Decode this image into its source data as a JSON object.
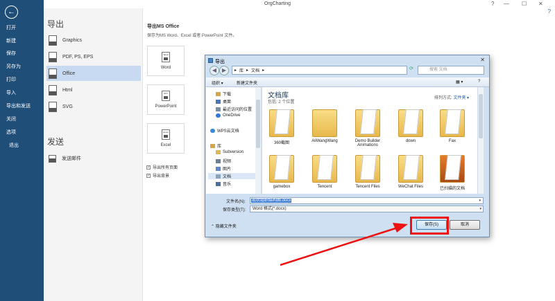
{
  "app": {
    "title": "OrgCharting",
    "help": "?"
  },
  "sidebar": {
    "items": [
      "打开",
      "新建",
      "保存",
      "另存为",
      "打印",
      "导入",
      "导出和发送",
      "关闭",
      "选项",
      "退出"
    ]
  },
  "column2": {
    "export_header": "导出",
    "formats": [
      "Graphics",
      "PDF, PS, EPS",
      "Office",
      "Html",
      "SVG"
    ],
    "format_icons": [
      "JPG",
      "PDF",
      "Word",
      "HTML",
      "SVG"
    ],
    "send_header": "发送",
    "send_items": [
      "发送邮件"
    ]
  },
  "content": {
    "title": "导出MS Office",
    "description": "保存为MS Word、Excel 或者 PowerPoint 文件。",
    "cards": [
      {
        "label": "Word",
        "icon": "Word"
      },
      {
        "label": "PowerPoint",
        "icon": "PPT"
      },
      {
        "label": "Excel",
        "icon": "Excel"
      }
    ],
    "checks": [
      "导出所有页面",
      "导出背景"
    ]
  },
  "dialog": {
    "title": "导出",
    "close": "✕",
    "address": [
      "库",
      "文档"
    ],
    "search_placeholder": "搜索 文档",
    "toolbar": {
      "organize": "组织 ▾",
      "new_folder": "新建文件夹"
    },
    "nav_items": [
      "下载",
      "桌面",
      "最近访问的位置",
      "OneDrive",
      "WPS云文档",
      "库",
      "Subversion",
      "视频",
      "图片",
      "文档",
      "音乐"
    ],
    "library_title": "文档库",
    "library_sub": "包括: 2 个位置",
    "arrange_label": "排列方式:",
    "arrange_value": "文件夹 ▾",
    "folders": [
      "360截图",
      "AliWangWang",
      "Demo Builder Animations",
      "down",
      "Fax",
      "gamebox",
      "Tencent",
      "Tencent Files",
      "WeChat Files",
      "已扫描的文档"
    ],
    "filename_label": "文件名(N):",
    "filename_value": "现状组织结构图.docx",
    "filetype_label": "保存类型(T):",
    "filetype_value": "Word 格式(*.docx)",
    "hide_folders": "隐藏文件夹",
    "save_button": "保存(S)",
    "cancel_button": "取消"
  },
  "colors": {
    "sidebar": "#1f4e79",
    "highlight": "#ee1111",
    "selected": "#c8daf1"
  }
}
